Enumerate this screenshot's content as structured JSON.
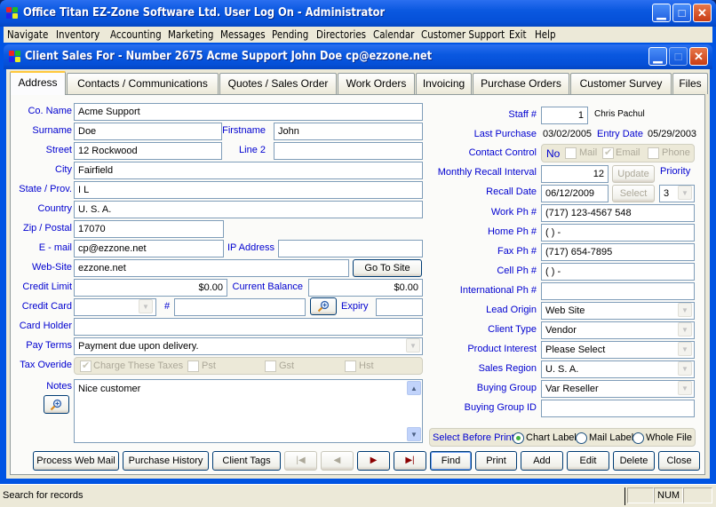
{
  "app": {
    "title": "Office Titan  EZ-Zone Software Ltd.   User Log On - Administrator",
    "controls": {
      "minimize": "_",
      "maximize": "□",
      "close": "X"
    }
  },
  "menu": [
    {
      "label": "Navigate"
    },
    {
      "label": "Inventory"
    },
    {
      "label": "Accounting"
    },
    {
      "label": "Marketing"
    },
    {
      "label": "Messages"
    },
    {
      "label": "Pending"
    },
    {
      "label": "Directories"
    },
    {
      "label": "Calendar"
    },
    {
      "label": "Customer Support"
    },
    {
      "label": "Exit"
    },
    {
      "label": "Help"
    }
  ],
  "window": {
    "title": "Client Sales For - Number 2675   Acme Support   John Doe   cp@ezzone.net"
  },
  "tabs": [
    {
      "label": "Address",
      "active": true
    },
    {
      "label": "Contacts / Communications"
    },
    {
      "label": "Quotes / Sales Order"
    },
    {
      "label": "Work Orders"
    },
    {
      "label": "Invoicing"
    },
    {
      "label": "Purchase Orders"
    },
    {
      "label": "Customer Survey"
    },
    {
      "label": "Files"
    }
  ],
  "left": {
    "co_name": {
      "label": "Co. Name",
      "value": "Acme Support"
    },
    "surname": {
      "label": "Surname",
      "value": "Doe"
    },
    "firstname": {
      "label": "Firstname",
      "value": "John"
    },
    "street": {
      "label": "Street",
      "value": "12 Rockwood"
    },
    "line2": {
      "label": "Line 2",
      "value": ""
    },
    "city": {
      "label": "City",
      "value": "Fairfield"
    },
    "state": {
      "label": "State / Prov.",
      "value": "I L"
    },
    "country": {
      "label": "Country",
      "value": "U. S. A."
    },
    "zip": {
      "label": "Zip / Postal",
      "value": "17070"
    },
    "email": {
      "label": "E - mail",
      "value": "cp@ezzone.net"
    },
    "ip": {
      "label": "IP Address",
      "value": ""
    },
    "website": {
      "label": "Web-Site",
      "value": "ezzone.net"
    },
    "go_to_site": "Go To Site",
    "credit_limit": {
      "label": "Credit Limit",
      "value": "$0.00"
    },
    "current_balance": {
      "label": "Current Balance",
      "value": "$0.00"
    },
    "credit_card": {
      "label": "Credit Card",
      "value": ""
    },
    "card_number": {
      "label": "#",
      "value": ""
    },
    "expiry": {
      "label": "Expiry",
      "value": ""
    },
    "card_holder": {
      "label": "Card Holder",
      "value": ""
    },
    "pay_terms": {
      "label": "Pay Terms",
      "value": "Payment due upon delivery."
    },
    "tax": {
      "label": "Tax Overide",
      "charge": {
        "label": "Charge These Taxes",
        "checked": true
      },
      "pst": {
        "label": "Pst",
        "checked": false
      },
      "gst": {
        "label": "Gst",
        "checked": false
      },
      "hst": {
        "label": "Hst",
        "checked": false
      }
    },
    "notes": {
      "label": "Notes",
      "value": "Nice customer"
    }
  },
  "right": {
    "staff": {
      "label": "Staff #",
      "value": "1",
      "name": "Chris Pachul"
    },
    "last_purchase": {
      "label": "Last Purchase",
      "value": "03/02/2005"
    },
    "entry_date": {
      "label": "Entry Date",
      "value": "05/29/2003"
    },
    "contact_control": {
      "label": "Contact Control",
      "no_label": "No",
      "mail": {
        "label": "Mail",
        "checked": false
      },
      "email": {
        "label": "Email",
        "checked": true
      },
      "phone": {
        "label": "Phone",
        "checked": false
      }
    },
    "recall_interval": {
      "label": "Monthly Recall Interval",
      "value": "12"
    },
    "update": "Update",
    "priority": {
      "label": "Priority",
      "value": "3"
    },
    "recall_date": {
      "label": "Recall Date",
      "value": "06/12/2009"
    },
    "select": "Select",
    "work_ph": {
      "label": "Work Ph #",
      "value": "(717) 123-4567 548"
    },
    "home_ph": {
      "label": "Home Ph #",
      "value": "(   )    -"
    },
    "fax_ph": {
      "label": "Fax Ph #",
      "value": "(717) 654-7895"
    },
    "cell_ph": {
      "label": "Cell Ph #",
      "value": "(   )    -"
    },
    "intl_ph": {
      "label": "International Ph #",
      "value": ""
    },
    "lead_origin": {
      "label": "Lead Origin",
      "value": "Web Site"
    },
    "client_type": {
      "label": "Client Type",
      "value": "Vendor"
    },
    "product_interest": {
      "label": "Product Interest",
      "value": "Please Select"
    },
    "sales_region": {
      "label": "Sales Region",
      "value": "U. S. A."
    },
    "buying_group": {
      "label": "Buying Group",
      "value": "Var Reseller"
    },
    "buying_group_id": {
      "label": "Buying Group ID",
      "value": ""
    },
    "print_select": {
      "label": "Select Before Print",
      "options": [
        {
          "label": "Chart Label",
          "selected": true
        },
        {
          "label": "Mail Label",
          "selected": false
        },
        {
          "label": "Whole File",
          "selected": false
        }
      ]
    }
  },
  "buttons": {
    "process_web_mail": "Process Web Mail",
    "purchase_history": "Purchase History",
    "client_tags": "Client Tags",
    "first": "|◀",
    "prev": "◀",
    "next": "▶",
    "last": "▶|",
    "find": "Find",
    "print": "Print",
    "add": "Add",
    "edit": "Edit",
    "delete": "Delete",
    "close": "Close"
  },
  "status": {
    "text": "Search for records",
    "num": "NUM"
  },
  "colors": {
    "title_blue": "#0054e3",
    "label_blue": "#0000d0",
    "face": "#ece9d8",
    "next_arrow": "#8b0000"
  }
}
